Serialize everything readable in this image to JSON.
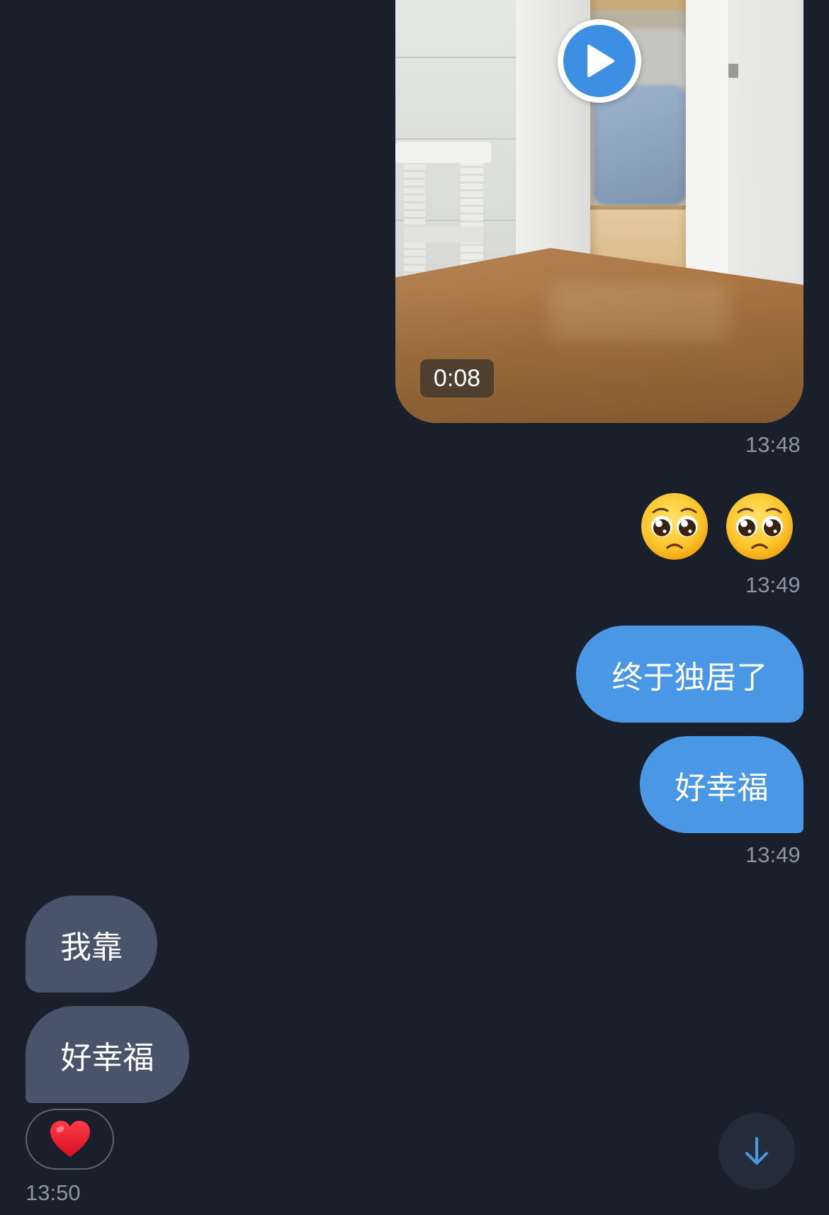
{
  "video_message": {
    "duration": "0:08",
    "timestamp": "13:48",
    "play_icon": "play-icon"
  },
  "emoji_message": {
    "emojis": [
      "🥺",
      "🥺"
    ],
    "timestamp": "13:49"
  },
  "outgoing_messages": [
    {
      "text": "终于独居了"
    },
    {
      "text": "好幸福"
    }
  ],
  "outgoing_timestamp": "13:49",
  "incoming_messages": [
    {
      "text": "我靠"
    },
    {
      "text": "好幸福"
    }
  ],
  "reaction": {
    "emoji": "❤️"
  },
  "incoming_timestamp": "13:50",
  "scroll_button": {
    "icon": "arrow-down-icon"
  },
  "colors": {
    "background": "#19202b",
    "outgoing_bubble": "#4a97e6",
    "incoming_bubble": "#47546a",
    "accent": "#3d8fe4",
    "timestamp": "#8b95a3"
  }
}
